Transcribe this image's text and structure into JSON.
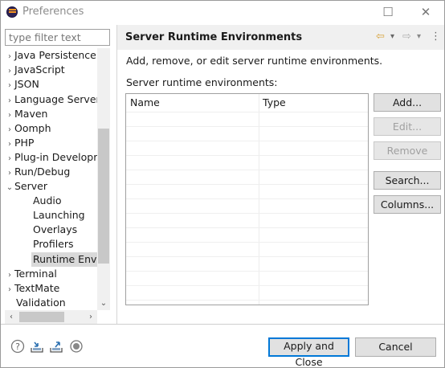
{
  "window": {
    "title": "Preferences",
    "minimize_glyph": "☐",
    "close_glyph": "✕"
  },
  "filter": {
    "placeholder": "type filter text",
    "value": ""
  },
  "tree": {
    "items": [
      {
        "label": "Java Persistence",
        "chevron": "›",
        "level": 0
      },
      {
        "label": "JavaScript",
        "chevron": "›",
        "level": 0
      },
      {
        "label": "JSON",
        "chevron": "›",
        "level": 0
      },
      {
        "label": "Language Server",
        "chevron": "›",
        "level": 0
      },
      {
        "label": "Maven",
        "chevron": "›",
        "level": 0
      },
      {
        "label": "Oomph",
        "chevron": "›",
        "level": 0
      },
      {
        "label": "PHP",
        "chevron": "›",
        "level": 0
      },
      {
        "label": "Plug-in Developr",
        "chevron": "›",
        "level": 0
      },
      {
        "label": "Run/Debug",
        "chevron": "›",
        "level": 0
      },
      {
        "label": "Server",
        "chevron": "⌄",
        "level": 0
      },
      {
        "label": "Audio",
        "chevron": "",
        "level": 1
      },
      {
        "label": "Launching",
        "chevron": "",
        "level": 1
      },
      {
        "label": "Overlays",
        "chevron": "",
        "level": 1
      },
      {
        "label": "Profilers",
        "chevron": "",
        "level": 1
      },
      {
        "label": "Runtime Envir",
        "chevron": "",
        "level": 1,
        "selected": true
      },
      {
        "label": "Terminal",
        "chevron": "›",
        "level": 0
      },
      {
        "label": "TextMate",
        "chevron": "›",
        "level": 0
      },
      {
        "label": "Validation",
        "chevron": "",
        "level": 0
      }
    ]
  },
  "page": {
    "title": "Server Runtime Environments",
    "description": "Add, remove, or edit server runtime environments.",
    "list_label": "Server runtime environments:",
    "columns": [
      "Name",
      "Type"
    ],
    "rows": []
  },
  "buttons": {
    "add": "Add...",
    "edit": "Edit...",
    "remove": "Remove",
    "search": "Search...",
    "columns": "Columns...",
    "apply_close": "Apply and Close",
    "cancel": "Cancel"
  },
  "icons": {
    "back": "⇦",
    "forward": "⇨",
    "dropdown": "▾",
    "menu": "⋮",
    "help": "?",
    "import": "import-icon",
    "export": "export-icon",
    "record": "record-icon"
  },
  "colors": {
    "focus_border": "#0078d7",
    "header_bg": "#f0f0f0",
    "button_bg": "#e1e1e1"
  }
}
